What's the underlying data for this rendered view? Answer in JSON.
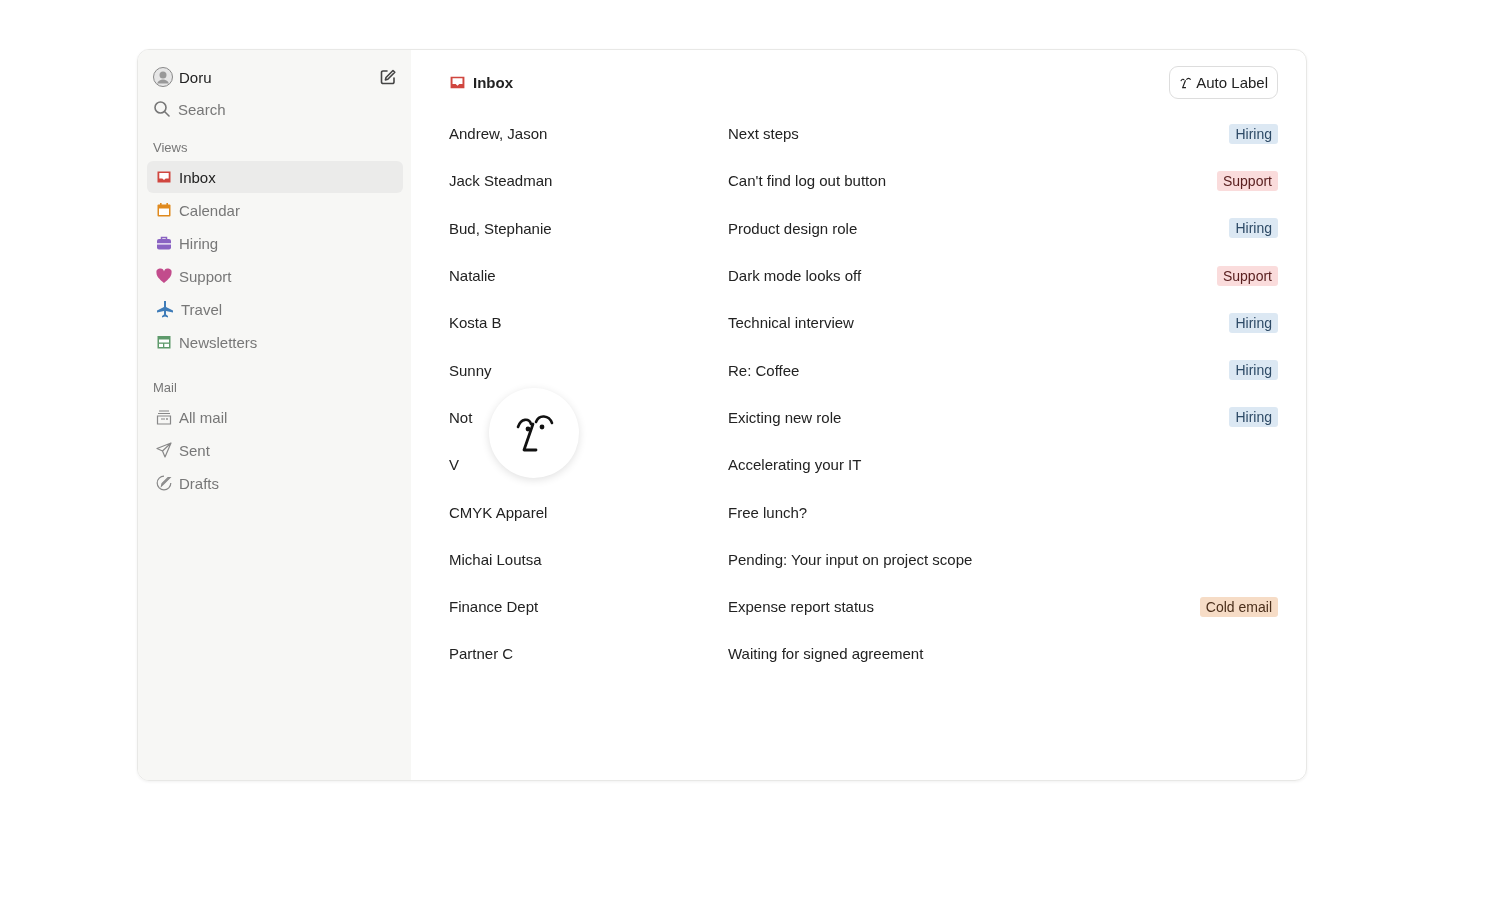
{
  "sidebar": {
    "user": "Doru",
    "search": "Search",
    "sections": [
      {
        "title": "Views",
        "items": [
          {
            "label": "Inbox",
            "selected": true
          },
          {
            "label": "Calendar",
            "selected": false
          },
          {
            "label": "Hiring",
            "selected": false
          },
          {
            "label": "Support",
            "selected": false
          },
          {
            "label": "Travel",
            "selected": false
          },
          {
            "label": "Newsletters",
            "selected": false
          }
        ]
      },
      {
        "title": "Mail",
        "items": [
          {
            "label": "All mail",
            "selected": false
          },
          {
            "label": "Sent",
            "selected": false
          },
          {
            "label": "Drafts",
            "selected": false
          }
        ]
      }
    ]
  },
  "main": {
    "title": "Inbox",
    "action": "Auto Label",
    "rows": [
      {
        "sender": "Andrew, Jason",
        "subject": "Next steps",
        "tag": {
          "label": "Hiring",
          "color": "#dce8f3"
        }
      },
      {
        "sender": "Jack Steadman",
        "subject": "Can't find log out button",
        "tag": {
          "label": "Support",
          "color": "#fadcdc"
        }
      },
      {
        "sender": "Bud, Stephanie",
        "subject": "Product design role",
        "tag": {
          "label": "Hiring",
          "color": "#dce8f3"
        }
      },
      {
        "sender": "Natalie",
        "subject": "Dark mode looks off",
        "tag": {
          "label": "Support",
          "color": "#fadcdc"
        }
      },
      {
        "sender": "Kosta B",
        "subject": "Technical interview",
        "tag": {
          "label": "Hiring",
          "color": "#dce8f3"
        }
      },
      {
        "sender": "Sunny",
        "subject": "Re: Coffee",
        "tag": {
          "label": "Hiring",
          "color": "#dce8f3"
        }
      },
      {
        "sender": "Not",
        "subject": "Exicting new role",
        "tag": {
          "label": "Hiring",
          "color": "#dce8f3"
        }
      },
      {
        "sender": "V",
        "subject": "Accelerating your IT"
      },
      {
        "sender": "CMYK Apparel",
        "subject": "Free lunch?"
      },
      {
        "sender": "Michai Loutsa",
        "subject": "Pending: Your input on project scope"
      },
      {
        "sender": "Finance Dept",
        "subject": "Expense report status",
        "tag": {
          "label": "Cold email",
          "color": "#f6dcc6"
        }
      },
      {
        "sender": "Partner C",
        "subject": "Waiting for signed agreement"
      }
    ]
  }
}
